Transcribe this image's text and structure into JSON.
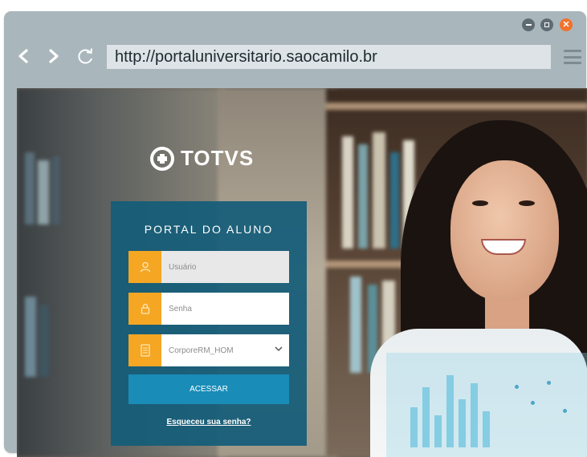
{
  "browser": {
    "url": "http://portaluniversitario.saocamilo.br",
    "back_icon": "chevron-left-icon",
    "forward_icon": "chevron-right-icon",
    "reload_icon": "reload-icon",
    "menu_icon": "hamburger-menu-icon",
    "window_controls": {
      "minimize_icon": "minimize-icon",
      "maximize_icon": "maximize-icon",
      "close_icon": "close-icon",
      "close_color": "#f2712b"
    }
  },
  "page": {
    "logo_text": "TOTVS",
    "login": {
      "title": "PORTAL DO ALUNO",
      "username_placeholder": "Usuário",
      "password_placeholder": "Senha",
      "database_value": "CorporeRM_HOM",
      "submit_label": "ACESSAR",
      "forgot_label": "Esqueceu sua senha?",
      "accent_color": "#f5a623",
      "panel_color": "#145c78",
      "button_color": "#1a8cb8"
    }
  }
}
